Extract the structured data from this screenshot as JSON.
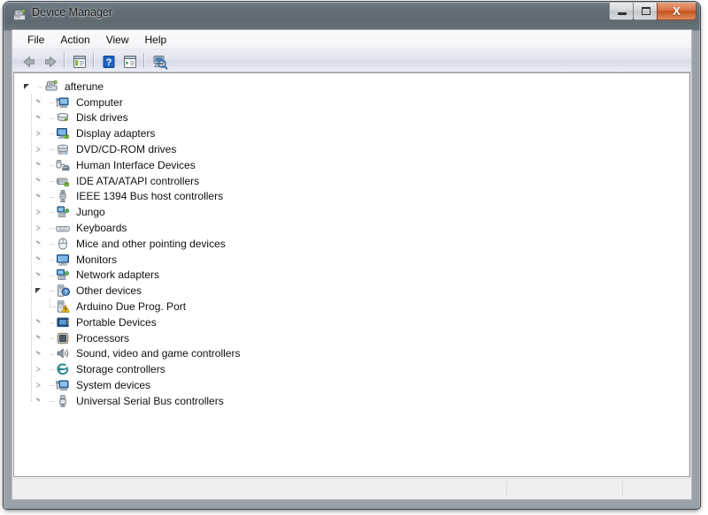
{
  "window": {
    "title": "Device Manager",
    "title_icon": "device-manager-icon",
    "controls": {
      "minimize_label": "–",
      "maximize_label": "□",
      "close_label": "X"
    }
  },
  "menubar": {
    "items": [
      {
        "label": "File",
        "name": "menu-file"
      },
      {
        "label": "Action",
        "name": "menu-action"
      },
      {
        "label": "View",
        "name": "menu-view"
      },
      {
        "label": "Help",
        "name": "menu-help"
      }
    ]
  },
  "toolbar": {
    "buttons": [
      {
        "name": "back-button",
        "icon": "back-arrow-icon",
        "title": "Back"
      },
      {
        "name": "forward-button",
        "icon": "forward-arrow-icon",
        "title": "Forward"
      },
      {
        "name": "show-console-tree-button",
        "icon": "console-tree-icon",
        "title": "Show/Hide Console Tree"
      },
      {
        "name": "help-button",
        "icon": "help-question-icon",
        "title": "Help"
      },
      {
        "name": "properties-button",
        "icon": "properties-icon",
        "title": "Properties"
      },
      {
        "name": "scan-hardware-button",
        "icon": "scan-hardware-changes-icon",
        "title": "Scan for hardware changes"
      }
    ]
  },
  "tree": {
    "root": {
      "label": "afterune",
      "icon": "computer-node-icon",
      "expanded": true
    },
    "nodes": [
      {
        "label": "Computer",
        "icon": "computer-icon",
        "expanded": false,
        "depth": 1
      },
      {
        "label": "Disk drives",
        "icon": "disk-drive-icon",
        "expanded": false,
        "depth": 1
      },
      {
        "label": "Display adapters",
        "icon": "display-adapter-icon",
        "expanded": false,
        "depth": 1
      },
      {
        "label": "DVD/CD-ROM drives",
        "icon": "dvd-drive-icon",
        "expanded": false,
        "depth": 1
      },
      {
        "label": "Human Interface Devices",
        "icon": "hid-icon",
        "expanded": false,
        "depth": 1
      },
      {
        "label": "IDE ATA/ATAPI controllers",
        "icon": "ide-controller-icon",
        "expanded": false,
        "depth": 1
      },
      {
        "label": "IEEE 1394 Bus host controllers",
        "icon": "ieee1394-icon",
        "expanded": false,
        "depth": 1
      },
      {
        "label": "Jungo",
        "icon": "network-node-icon",
        "expanded": false,
        "depth": 1
      },
      {
        "label": "Keyboards",
        "icon": "keyboard-icon",
        "expanded": false,
        "depth": 1
      },
      {
        "label": "Mice and other pointing devices",
        "icon": "mouse-icon",
        "expanded": false,
        "depth": 1
      },
      {
        "label": "Monitors",
        "icon": "monitor-icon",
        "expanded": false,
        "depth": 1
      },
      {
        "label": "Network adapters",
        "icon": "network-adapter-icon",
        "expanded": false,
        "depth": 1
      },
      {
        "label": "Other devices",
        "icon": "other-devices-icon",
        "expanded": true,
        "depth": 1
      },
      {
        "label": "Arduino Due Prog. Port",
        "icon": "unknown-device-warning-icon",
        "expanded": null,
        "depth": 2,
        "warning": true
      },
      {
        "label": "Portable Devices",
        "icon": "portable-device-icon",
        "expanded": false,
        "depth": 1
      },
      {
        "label": "Processors",
        "icon": "processor-icon",
        "expanded": false,
        "depth": 1
      },
      {
        "label": "Sound, video and game controllers",
        "icon": "sound-controller-icon",
        "expanded": false,
        "depth": 1
      },
      {
        "label": "Storage controllers",
        "icon": "storage-controller-icon",
        "expanded": false,
        "depth": 1
      },
      {
        "label": "System devices",
        "icon": "system-device-icon",
        "expanded": false,
        "depth": 1
      },
      {
        "label": "Universal Serial Bus controllers",
        "icon": "usb-controller-icon",
        "expanded": false,
        "depth": 1
      }
    ]
  },
  "statusbar": {
    "text": "",
    "segment2": "",
    "segment3": ""
  },
  "colors": {
    "titlebar": "#5c6870",
    "close_button": "#c2531f",
    "toolbar_gradient_top": "#ecedf4",
    "toolbar_gradient_bottom": "#eef0f6",
    "tree_background": "#ffffff",
    "warning_badge": "#f5c117"
  }
}
